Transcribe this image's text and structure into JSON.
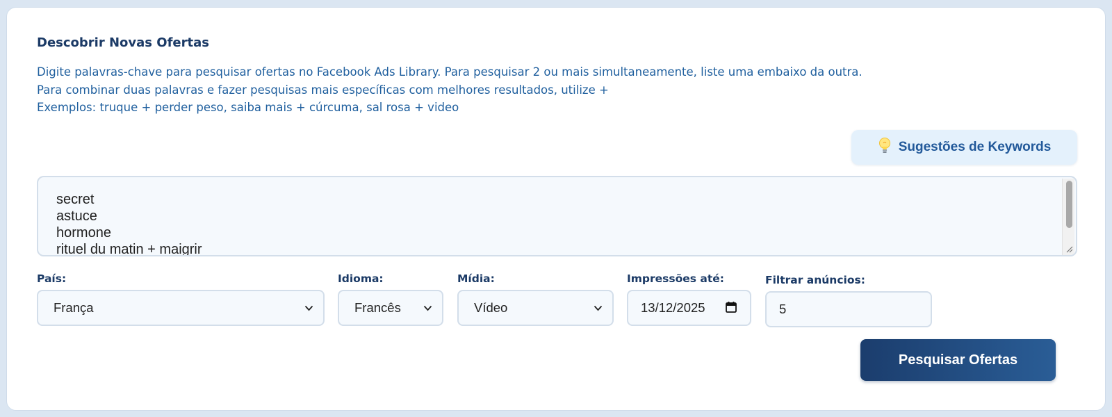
{
  "section": {
    "title": "Descobrir Novas Ofertas",
    "description": [
      "Digite palavras-chave para pesquisar ofertas no Facebook Ads Library. Para pesquisar 2 ou mais simultaneamente, liste uma embaixo da outra.",
      "Para combinar duas palavras e fazer pesquisas mais específicas com melhores resultados, utilize +",
      "Exemplos: truque + perder peso, saiba mais + cúrcuma, sal rosa + video"
    ]
  },
  "keyword_suggestions_button": {
    "icon": "lightbulb-icon",
    "label": "Sugestões de Keywords"
  },
  "keywords_textarea": {
    "lines": [
      "secret",
      "astuce",
      "hormone",
      "rituel du matin + maigrir"
    ]
  },
  "filters": {
    "country": {
      "label": "País:",
      "value": "França"
    },
    "language": {
      "label": "Idioma:",
      "value": "Francês"
    },
    "media": {
      "label": "Mídia:",
      "value": "Vídeo"
    },
    "impressions_until": {
      "label": "Impressões até:",
      "value": "13/12/2025"
    },
    "filter_ads": {
      "label": "Filtrar anúncios:",
      "value": "5"
    }
  },
  "search_button": {
    "label": "Pesquisar Ofertas"
  },
  "colors": {
    "primary_dark": "#1b3d6d",
    "primary": "#2a5d96",
    "text_blue": "#1f5f9e",
    "heading": "#1b3a66",
    "field_bg": "#f5f9fd"
  }
}
